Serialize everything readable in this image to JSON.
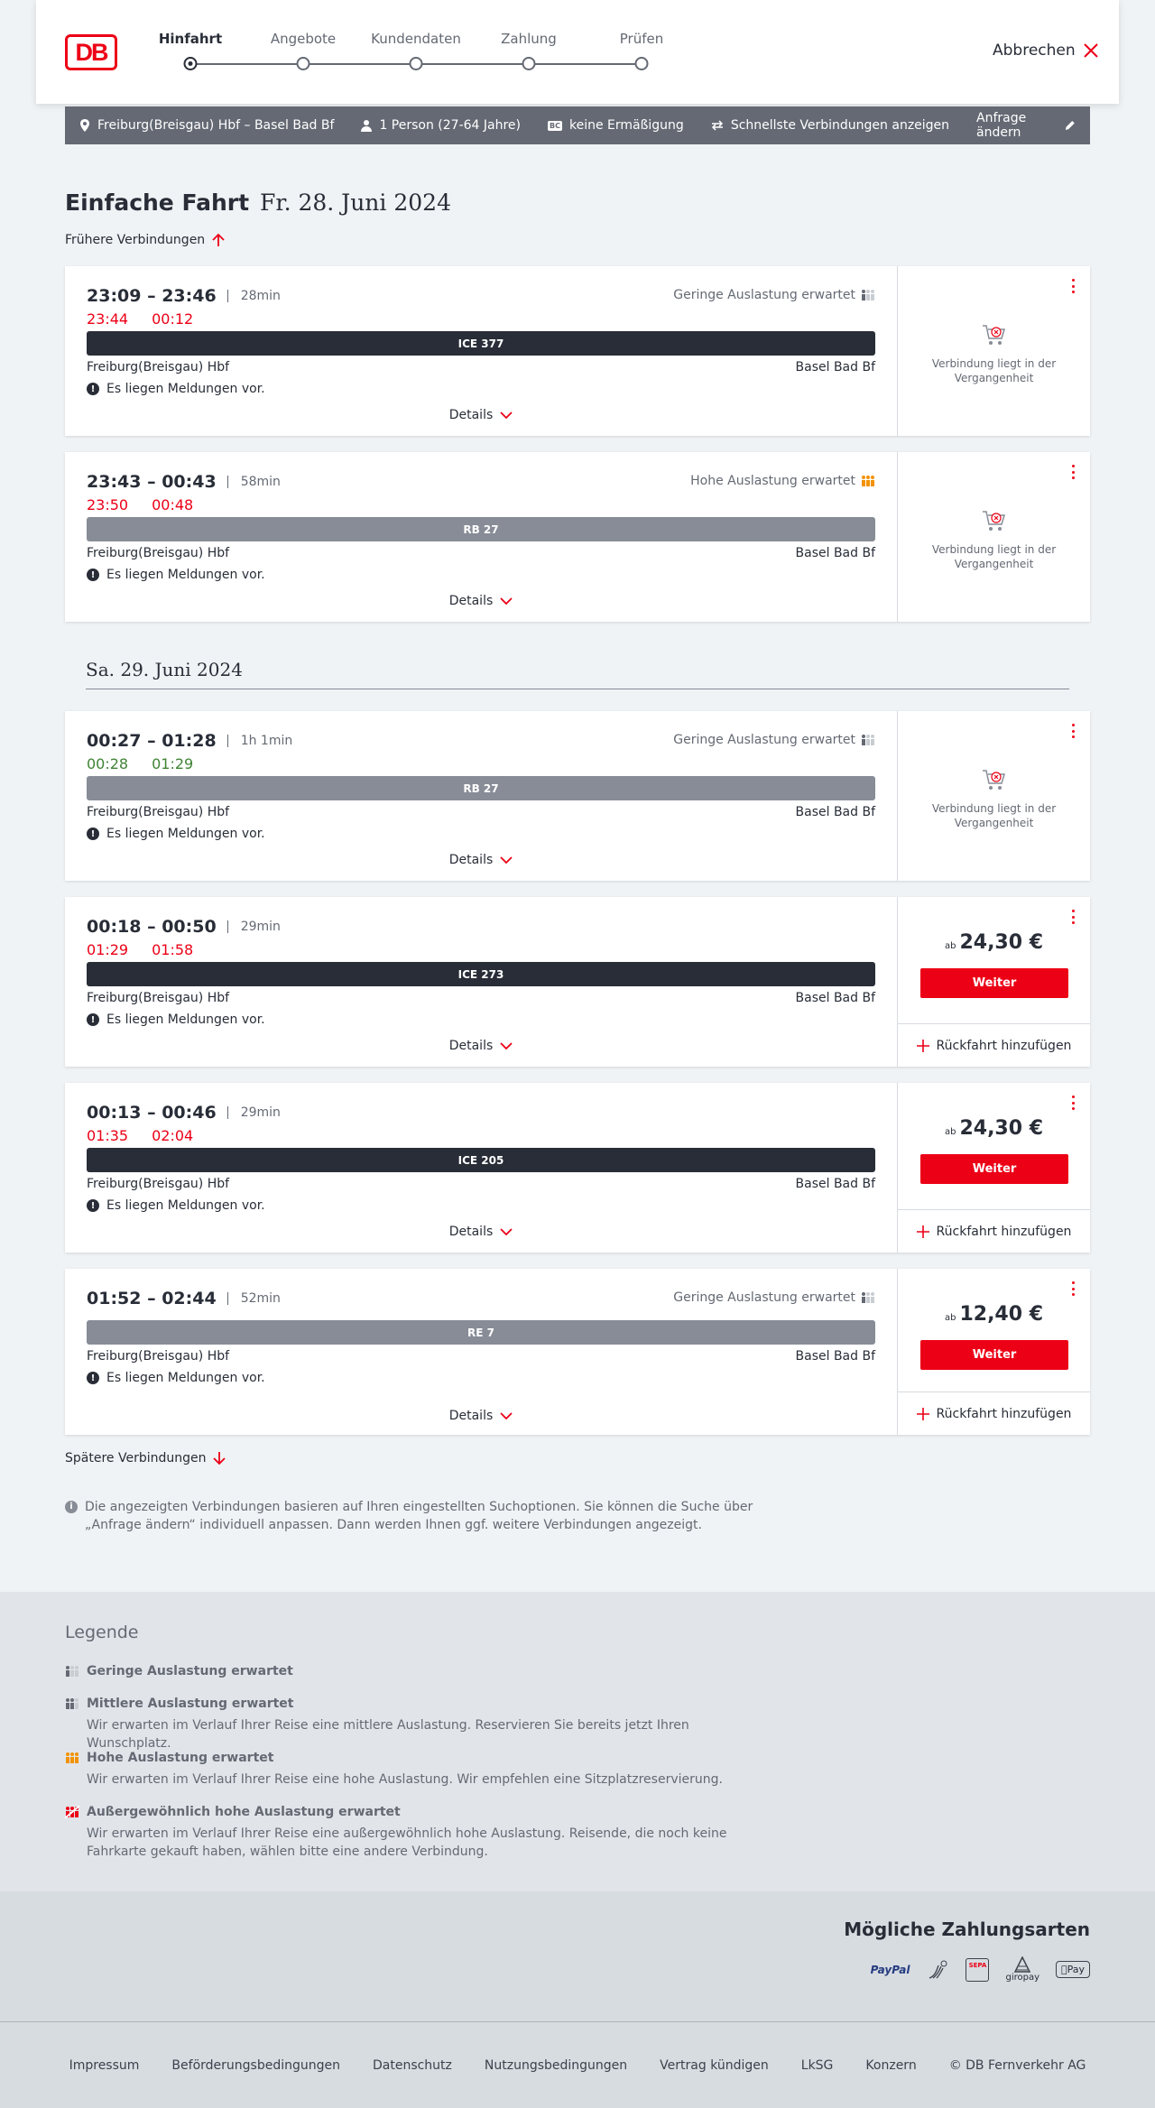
{
  "header": {
    "logo": "DB",
    "steps": [
      "Hinfahrt",
      "Angebote",
      "Kundendaten",
      "Zahlung",
      "Prüfen"
    ],
    "cancel_label": "Abbrechen"
  },
  "search_bar": {
    "route": "Freiburg(Breisgau) Hbf – Basel Bad Bf",
    "persons": "1 Person (27-64 Jahre)",
    "discount_badge": "BC",
    "discount": "keine Ermäßigung",
    "option": "Schnellste Verbindungen anzeigen",
    "change_label": "Anfrage ändern"
  },
  "page": {
    "title_bold": "Einfache Fahrt",
    "title_date": "Fr. 28. Juni 2024",
    "earlier_label": "Frühere Verbindungen",
    "later_label": "Spätere Verbindungen",
    "day_separator": "Sa. 29. Juni 2024",
    "note": "Die angezeigten Verbindungen basieren auf Ihren eingestellten Suchoptionen. Sie können die Suche über „Anfrage ändern“ individuell anpassen. Dann werden Ihnen ggf. weitere Verbindungen angezeigt."
  },
  "connections": [
    {
      "times": "23:09 – 23:46",
      "duration": "28min",
      "rt_dep": "23:44",
      "rt_arr": "00:12",
      "rt_status": "late",
      "load": "Geringe Auslastung erwartet",
      "load_level": "low",
      "train": "ICE 377",
      "train_style": "dark",
      "from": "Freiburg(Breisgau) Hbf",
      "to": "Basel Bad Bf",
      "message": "Es liegen Meldungen vor.",
      "details": "Details",
      "past_text": "Verbindung liegt in der Vergangenheit"
    },
    {
      "times": "23:43 – 00:43",
      "duration": "58min",
      "rt_dep": "23:50",
      "rt_arr": "00:48",
      "rt_status": "late",
      "load": "Hohe Auslastung erwartet",
      "load_level": "high",
      "train": "RB 27",
      "train_style": "grey",
      "from": "Freiburg(Breisgau) Hbf",
      "to": "Basel Bad Bf",
      "message": "Es liegen Meldungen vor.",
      "details": "Details",
      "past_text": "Verbindung liegt in der Vergangenheit"
    },
    {
      "times": "00:27 – 01:28",
      "duration": "1h 1min",
      "rt_dep": "00:28",
      "rt_arr": "01:29",
      "rt_status": "ok",
      "load": "Geringe Auslastung erwartet",
      "load_level": "low",
      "train": "RB 27",
      "train_style": "grey",
      "from": "Freiburg(Breisgau) Hbf",
      "to": "Basel Bad Bf",
      "message": "Es liegen Meldungen vor.",
      "details": "Details",
      "past_text": "Verbindung liegt in der Vergangenheit"
    },
    {
      "times": "00:18 – 00:50",
      "duration": "29min",
      "rt_dep": "01:29",
      "rt_arr": "01:58",
      "rt_status": "late",
      "train": "ICE 273",
      "train_style": "dark",
      "from": "Freiburg(Breisgau) Hbf",
      "to": "Basel Bad Bf",
      "message": "Es liegen Meldungen vor.",
      "details": "Details",
      "price_prefix": "ab",
      "price": "24,30 €",
      "weiter": "Weiter",
      "return": "Rückfahrt hinzufügen"
    },
    {
      "times": "00:13 – 00:46",
      "duration": "29min",
      "rt_dep": "01:35",
      "rt_arr": "02:04",
      "rt_status": "late",
      "train": "ICE 205",
      "train_style": "dark",
      "from": "Freiburg(Breisgau) Hbf",
      "to": "Basel Bad Bf",
      "message": "Es liegen Meldungen vor.",
      "details": "Details",
      "price_prefix": "ab",
      "price": "24,30 €",
      "weiter": "Weiter",
      "return": "Rückfahrt hinzufügen"
    },
    {
      "times": "01:52 – 02:44",
      "duration": "52min",
      "load": "Geringe Auslastung erwartet",
      "load_level": "low",
      "train": "RE 7",
      "train_style": "grey",
      "from": "Freiburg(Breisgau) Hbf",
      "to": "Basel Bad Bf",
      "message": "Es liegen Meldungen vor.",
      "details": "Details",
      "price_prefix": "ab",
      "price": "12,40 €",
      "weiter": "Weiter",
      "return": "Rückfahrt hinzufügen"
    }
  ],
  "legend": {
    "title": "Legende",
    "items": [
      {
        "title": "Geringe Auslastung erwartet",
        "desc": ""
      },
      {
        "title": "Mittlere Auslastung erwartet",
        "desc": "Wir erwarten im Verlauf Ihrer Reise eine mittlere Auslastung. Reservieren Sie bereits jetzt Ihren Wunschplatz."
      },
      {
        "title": "Hohe Auslastung erwartet",
        "desc": "Wir erwarten im Verlauf Ihrer Reise eine hohe Auslastung. Wir empfehlen eine Sitzplatzreservierung."
      },
      {
        "title": "Außergewöhnlich hohe Auslastung erwartet",
        "desc": "Wir erwarten im Verlauf Ihrer Reise eine außergewöhnlich hohe Auslastung. Reisende, die noch keine Fahrkarte gekauft haben, wählen bitte eine andere Verbindung."
      }
    ]
  },
  "payment": {
    "title": "Mögliche Zahlungsarten",
    "paypal": "PayPal",
    "sepa": "SEPA",
    "giropay": "giropay",
    "applepay": "Pay"
  },
  "footer": [
    "Impressum",
    "Beförderungsbedingungen",
    "Datenschutz",
    "Nutzungsbedingungen",
    "Vertrag kündigen",
    "LkSG",
    "Konzern",
    "© DB Fernverkehr AG"
  ],
  "colors": {
    "accent": "#ec0016",
    "text": "#282d37",
    "grey": "#646973",
    "ok": "#408335",
    "warn": "#f39200"
  }
}
